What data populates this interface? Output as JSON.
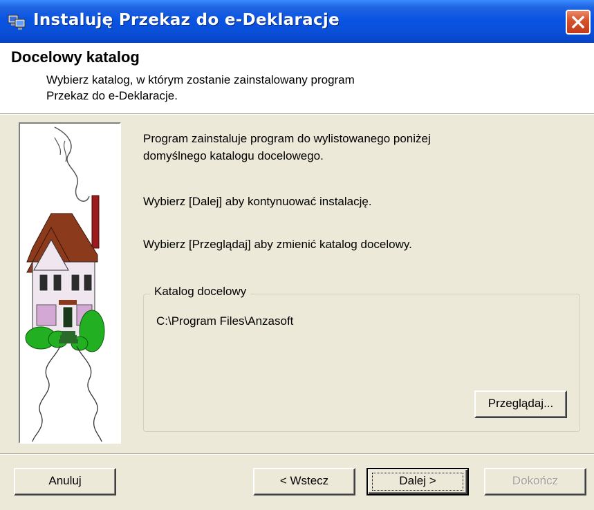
{
  "window": {
    "title": "Instaluję Przekaz do e-Deklaracje",
    "title_icon": "installer-computer-icon",
    "close_icon": "close-icon"
  },
  "header": {
    "title": "Docelowy katalog",
    "subtitle_line1": "Wybierz katalog, w którym zostanie zainstalowany program",
    "subtitle_line2": "Przekaz do e-Deklaracje."
  },
  "illustration": {
    "name": "house-illustration"
  },
  "body": {
    "info1_line1": "Program zainstaluje program do wylistowanego poniżej",
    "info1_line2": "domyślnego katalogu docelowego.",
    "info2": "Wybierz [Dalej] aby kontynuować instalację.",
    "info3": "Wybierz [Przeglądaj] aby zmienić katalog docelowy."
  },
  "destination": {
    "group_label": "Katalog docelowy",
    "path": "C:\\Program Files\\Anzasoft",
    "browse_label": "Przeglądaj..."
  },
  "buttons": {
    "cancel": "Anuluj",
    "back": "< Wstecz",
    "next": "Dalej >",
    "finish": "Dokończ"
  },
  "colors": {
    "titlebar": "#0A54E3",
    "dialog_bg": "#ECE9D8",
    "close_button": "#C23A1A",
    "disabled_text": "#A19F95"
  }
}
